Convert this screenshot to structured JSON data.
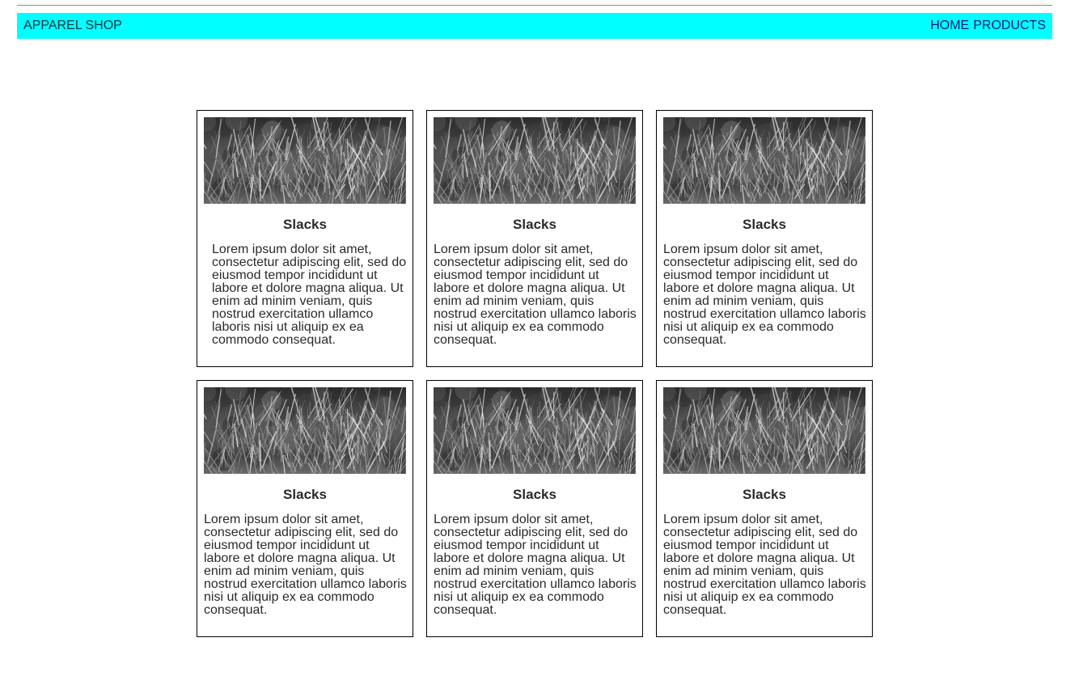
{
  "header": {
    "brand": "APPAREL SHOP",
    "nav": [
      {
        "label": "HOME"
      },
      {
        "label": "PRODUCTS"
      }
    ]
  },
  "products": [
    {
      "title": "Slacks",
      "description": "Lorem ipsum dolor sit amet, consectetur adipiscing elit, sed do eiusmod tempor incididunt ut labore et dolore magna aliqua. Ut enim ad minim veniam, quis nostrud exercitation ullamco laboris nisi ut aliquip ex ea commodo consequat.",
      "image": "grass-photo"
    },
    {
      "title": "Slacks",
      "description": "Lorem ipsum dolor sit amet, consectetur adipiscing elit, sed do eiusmod tempor incididunt ut labore et dolore magna aliqua. Ut enim ad minim veniam, quis nostrud exercitation ullamco laboris nisi ut aliquip ex ea commodo consequat.",
      "image": "grass-photo"
    },
    {
      "title": "Slacks",
      "description": "Lorem ipsum dolor sit amet, consectetur adipiscing elit, sed do eiusmod tempor incididunt ut labore et dolore magna aliqua. Ut enim ad minim veniam, quis nostrud exercitation ullamco laboris nisi ut aliquip ex ea commodo consequat.",
      "image": "grass-photo"
    },
    {
      "title": "Slacks",
      "description": "Lorem ipsum dolor sit amet, consectetur adipiscing elit, sed do eiusmod tempor incididunt ut labore et dolore magna aliqua. Ut enim ad minim veniam, quis nostrud exercitation ullamco laboris nisi ut aliquip ex ea commodo consequat.",
      "image": "grass-photo"
    },
    {
      "title": "Slacks",
      "description": "Lorem ipsum dolor sit amet, consectetur adipiscing elit, sed do eiusmod tempor incididunt ut labore et dolore magna aliqua. Ut enim ad minim veniam, quis nostrud exercitation ullamco laboris nisi ut aliquip ex ea commodo consequat.",
      "image": "grass-photo"
    },
    {
      "title": "Slacks",
      "description": "Lorem ipsum dolor sit amet, consectetur adipiscing elit, sed do eiusmod tempor incididunt ut labore et dolore magna aliqua. Ut enim ad minim veniam, quis nostrud exercitation ullamco laboris nisi ut aliquip ex ea commodo consequat.",
      "image": "grass-photo"
    }
  ],
  "colors": {
    "navbar_bg": "#00ffff",
    "nav_link": "#0a1c7a",
    "card_border": "#000000"
  }
}
